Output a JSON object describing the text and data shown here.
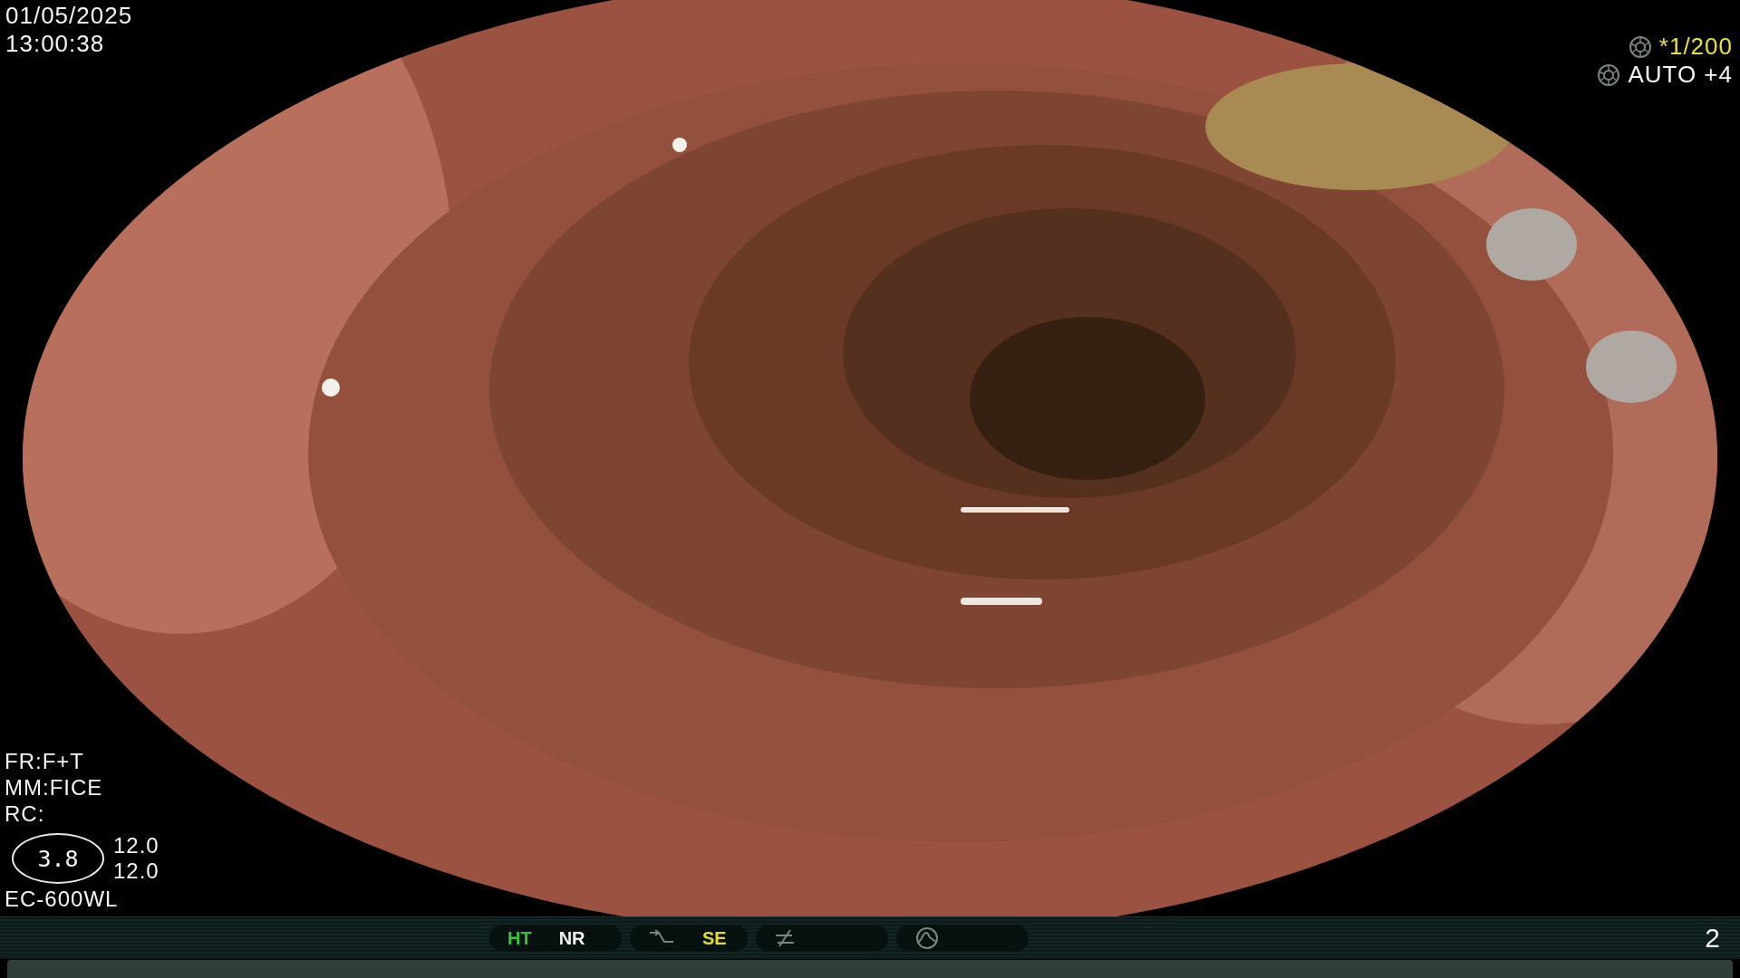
{
  "datetime": {
    "date": "01/05/2025",
    "time": "13:00:38"
  },
  "exposure": {
    "shutter": "*1/200",
    "iris": "AUTO +4"
  },
  "settings": [
    "FR:F+T",
    "MM:FICE",
    "RC:"
  ],
  "zoom": {
    "value": "3.8",
    "readings": [
      "12.0",
      "12.0"
    ]
  },
  "scope": "EC-600WL",
  "status_bar": {
    "pills": [
      {
        "kind": "plain",
        "items": [
          {
            "label": "HT",
            "color": "#3cc03c"
          },
          {
            "label": "NR",
            "color": "#f2f2f2"
          }
        ]
      },
      {
        "kind": "curve",
        "items": [
          {
            "label": "SE",
            "color": "#e4dc2a"
          }
        ]
      },
      {
        "kind": "slash"
      },
      {
        "kind": "peak"
      }
    ],
    "page": "2"
  }
}
